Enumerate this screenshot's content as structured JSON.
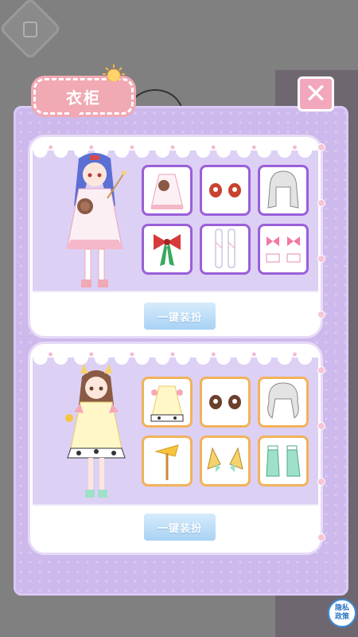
{
  "wardrobe": {
    "title": "衣柜",
    "close_label": "✕"
  },
  "outfits": [
    {
      "items": [
        "dress-with-bear-icon",
        "red-eyes-icon",
        "grey-hair-icon",
        "red-bow-icon",
        "white-stockings-icon",
        "pink-bow-shoes-icon"
      ],
      "equip_label": "一键装扮"
    },
    {
      "items": [
        "cow-print-dress-icon",
        "brown-eyes-icon",
        "grey-wavy-hair-icon",
        "cheese-wand-icon",
        "cat-ears-bow-icon",
        "mint-boots-icon"
      ],
      "equip_label": "一键装扮"
    }
  ],
  "privacy": {
    "line1": "隐私",
    "line2": "政策"
  },
  "colors": {
    "panel": "#cdb9ec",
    "accent_pink": "#f1a9b4",
    "card1_border": "#9a5fd9",
    "card2_border": "#f2b25a",
    "button_blue": "#a9d2f4"
  }
}
